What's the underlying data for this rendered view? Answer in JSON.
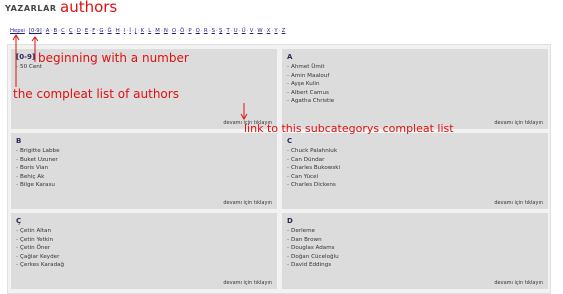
{
  "header": {
    "title": "YAZARLAR"
  },
  "nav": {
    "all_label": "Hepsi",
    "number_label": "[0-9]",
    "letters": [
      "A",
      "B",
      "C",
      "Ç",
      "D",
      "E",
      "F",
      "G",
      "Ğ",
      "H",
      "I",
      "İ",
      "J",
      "K",
      "L",
      "M",
      "N",
      "O",
      "Ö",
      "P",
      "Q",
      "R",
      "S",
      "Ş",
      "T",
      "U",
      "Ü",
      "V",
      "W",
      "X",
      "Y",
      "Z"
    ]
  },
  "cards": [
    {
      "title": "[0-9]",
      "authors": [
        "50 Cent"
      ],
      "more": "devamı için tıklayın"
    },
    {
      "title": "A",
      "authors": [
        "Ahmet Ümit",
        "Amin Maalouf",
        "Ayşe Kulin",
        "Albert Camus",
        "Agatha Christie"
      ],
      "more": "devamı için tıklayın"
    },
    {
      "title": "B",
      "authors": [
        "Brigitte Labbe",
        "Buket Uzuner",
        "Boris Vian",
        "Behiç Ak",
        "Bilge Karasu"
      ],
      "more": "devamı için tıklayın"
    },
    {
      "title": "C",
      "authors": [
        "Chuck Palahniuk",
        "Can Dündar",
        "Charles Bukowski",
        "Can Yücel",
        "Charles Dickens"
      ],
      "more": "devamı için tıklayın"
    },
    {
      "title": "Ç",
      "authors": [
        "Çetin Altan",
        "Çetin Yetkin",
        "Çetin Öner",
        "Çağlar Keyder",
        "Çerkes Karadağ"
      ],
      "more": "devamı için tıklayın"
    },
    {
      "title": "D",
      "authors": [
        "Derleme",
        "Dan Brown",
        "Douglas Adams",
        "Doğan Cüceloğlu",
        "David Eddings"
      ],
      "more": "devamı için tıklayın"
    }
  ],
  "annotations": {
    "authors": "authors",
    "number": "beginning with a number",
    "complete": "the compleat list of authors",
    "link": "link to this subcategorys compleat list",
    "color": "#e01010"
  }
}
